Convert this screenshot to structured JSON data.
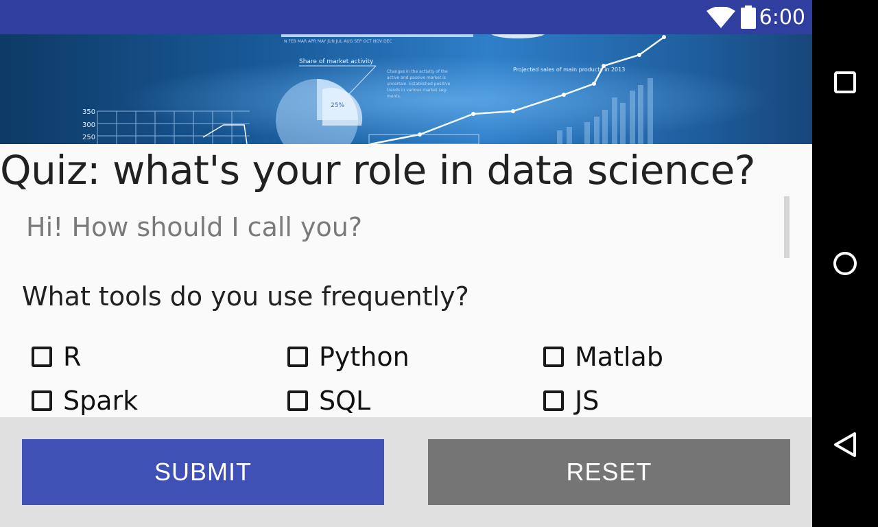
{
  "status_bar": {
    "time": "6:00",
    "color": "#303f9f"
  },
  "banner": {
    "icon": "data-analytics-banner-image",
    "texts": {
      "share_label": "Share of market activity",
      "pie_label": "25%",
      "projected_label": "Projected sales of main products in 2013",
      "axis_350": "350",
      "axis_300": "300",
      "axis_250": "250"
    }
  },
  "title": "Quiz: what's your role in data science?",
  "name_field": {
    "placeholder": "Hi! How should I call you?",
    "value": ""
  },
  "question": "What tools do you use frequently?",
  "options": [
    {
      "label": "R",
      "checked": false
    },
    {
      "label": "Python",
      "checked": false
    },
    {
      "label": "Matlab",
      "checked": false
    },
    {
      "label": "Spark",
      "checked": false
    },
    {
      "label": "SQL",
      "checked": false
    },
    {
      "label": "JS",
      "checked": false
    }
  ],
  "buttons": {
    "submit": "SUBMIT",
    "reset": "RESET"
  },
  "colors": {
    "primary": "#3f51b5",
    "primary_dark": "#303f9f",
    "reset": "#757575",
    "background": "#fafafa"
  },
  "nav": {
    "recents_icon": "square-recents-icon",
    "home_icon": "circle-home-icon",
    "back_icon": "triangle-back-icon"
  }
}
